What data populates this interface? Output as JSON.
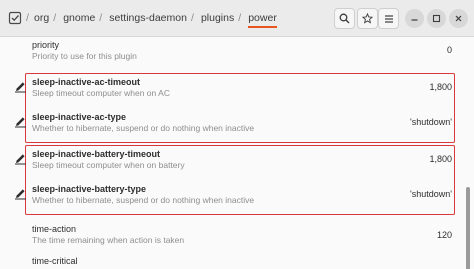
{
  "header": {
    "breadcrumbs": [
      "org",
      "gnome",
      "settings-daemon",
      "plugins",
      "power"
    ],
    "separator": "/",
    "root_icon": "folder-checkbox-icon",
    "buttons": [
      "search-icon",
      "star-icon",
      "menu-icon",
      "minimize-icon",
      "maximize-icon",
      "close-icon"
    ]
  },
  "accent_color": "#e95420",
  "highlight_color": "#d9373f",
  "rows": [
    {
      "key": "priority",
      "description": "Priority to use for this plugin",
      "value": "0",
      "modified": false
    },
    {
      "key": "sleep-inactive-ac-timeout",
      "description": "Sleep timeout computer when on AC",
      "value": "1,800",
      "modified": true
    },
    {
      "key": "sleep-inactive-ac-type",
      "description": "Whether to hibernate, suspend or do nothing when inactive",
      "value": "'shutdown'",
      "modified": true
    },
    {
      "key": "sleep-inactive-battery-timeout",
      "description": "Sleep timeout computer when on battery",
      "value": "1,800",
      "modified": true
    },
    {
      "key": "sleep-inactive-battery-type",
      "description": "Whether to hibernate, suspend or do nothing when inactive",
      "value": "'shutdown'",
      "modified": true
    },
    {
      "key": "time-action",
      "description": "The time remaining when action is taken",
      "value": "120",
      "modified": false
    },
    {
      "key": "time-critical",
      "description": "",
      "value": "",
      "modified": false
    }
  ]
}
